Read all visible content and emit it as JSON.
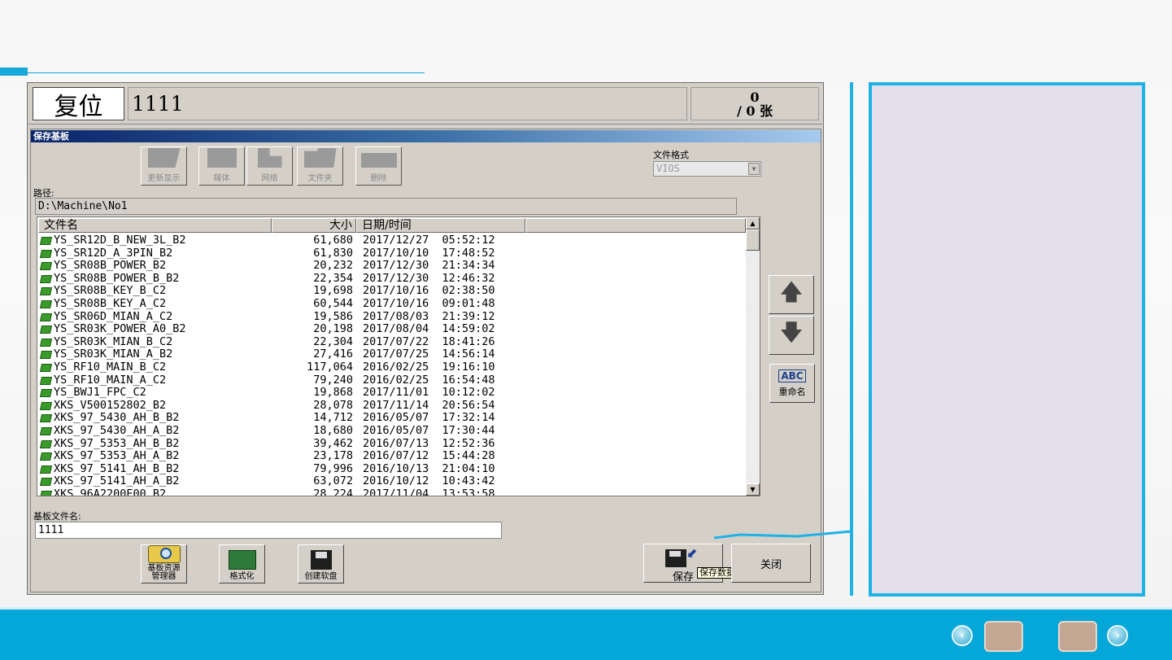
{
  "topbar": {
    "reset_label": "复位",
    "program_name": "1111",
    "count_current": "0",
    "count_total": "/ 0 张"
  },
  "dialog": {
    "title": "保存基板",
    "toolbar": [
      {
        "label": "更新显示",
        "icon": "refresh-icon"
      },
      {
        "label": "媒体",
        "icon": "media-icon"
      },
      {
        "label": "网络",
        "icon": "network-icon"
      },
      {
        "label": "文件夹",
        "icon": "folder-icon"
      },
      {
        "label": "删除",
        "icon": "delete-icon"
      }
    ],
    "file_format_label": "文件格式",
    "file_format_value": "VIOS",
    "path_label": "路径:",
    "path_value": "D:\\Machine\\No1",
    "columns": {
      "name": "文件名",
      "size": "大小",
      "date": "日期/时间"
    },
    "files": [
      {
        "name": "YS_SR12D_B_NEW_3L_B2",
        "size": "61,680",
        "date": "2017/12/27  05:52:12"
      },
      {
        "name": "YS_SR12D_A_3PIN_B2",
        "size": "61,830",
        "date": "2017/10/10  17:48:52"
      },
      {
        "name": "YS_SR08B_POWER_B2",
        "size": "20,232",
        "date": "2017/12/30  21:34:34"
      },
      {
        "name": "YS_SR08B_POWER_B_B2",
        "size": "22,354",
        "date": "2017/12/30  12:46:32"
      },
      {
        "name": "YS_SR08B_KEY_B_C2",
        "size": "19,698",
        "date": "2017/10/16  02:38:50"
      },
      {
        "name": "YS_SR08B_KEY_A_C2",
        "size": "60,544",
        "date": "2017/10/16  09:01:48"
      },
      {
        "name": "YS_SR06D_MIAN_A_C2",
        "size": "19,586",
        "date": "2017/08/03  21:39:12"
      },
      {
        "name": "YS_SR03K_POWER_A0_B2",
        "size": "20,198",
        "date": "2017/08/04  14:59:02"
      },
      {
        "name": "YS_SR03K_MIAN_B_C2",
        "size": "22,304",
        "date": "2017/07/22  18:41:26"
      },
      {
        "name": "YS_SR03K_MIAN_A_B2",
        "size": "27,416",
        "date": "2017/07/25  14:56:14"
      },
      {
        "name": "YS_RF10_MAIN_B_C2",
        "size": "117,064",
        "date": "2016/02/25  19:16:10"
      },
      {
        "name": "YS_RF10_MAIN_A_C2",
        "size": "79,240",
        "date": "2016/02/25  16:54:48"
      },
      {
        "name": "YS_BWJ1_FPC_C2",
        "size": "19,868",
        "date": "2017/11/01  10:12:02"
      },
      {
        "name": "XKS_V500152802_B2",
        "size": "28,078",
        "date": "2017/11/14  20:56:54"
      },
      {
        "name": "XKS_97_5430_AH_B_B2",
        "size": "14,712",
        "date": "2016/05/07  17:32:14"
      },
      {
        "name": "XKS_97_5430_AH_A_B2",
        "size": "18,680",
        "date": "2016/05/07  17:30:44"
      },
      {
        "name": "XKS_97_5353_AH_B_B2",
        "size": "39,462",
        "date": "2016/07/13  12:52:36"
      },
      {
        "name": "XKS_97_5353_AH_A_B2",
        "size": "23,178",
        "date": "2016/07/12  15:44:28"
      },
      {
        "name": "XKS_97_5141_AH_B_B2",
        "size": "79,996",
        "date": "2016/10/13  21:04:10"
      },
      {
        "name": "XKS_97_5141_AH_A_B2",
        "size": "63,072",
        "date": "2016/10/12  10:43:42"
      },
      {
        "name": "XKS_96A2200E00_B2",
        "size": "28,224",
        "date": "2017/11/04  13:53:58"
      }
    ],
    "rename_label": "重命名",
    "filename_label": "基板文件名:",
    "filename_value": "1111",
    "bottom_buttons": [
      {
        "label": "基板资源\n管理器",
        "icon": "board-explorer-icon"
      },
      {
        "label": "格式化",
        "icon": "format-icon"
      },
      {
        "label": "创建软盘",
        "icon": "floppy-icon"
      }
    ],
    "save_label": "保存",
    "save_tooltip": "保存数据",
    "close_label": "关闭"
  },
  "colors": {
    "accent": "#1fb2e6",
    "band": "#05a6d8",
    "panel": "#e3e0ec",
    "file_icon": "#3a9a2a"
  }
}
